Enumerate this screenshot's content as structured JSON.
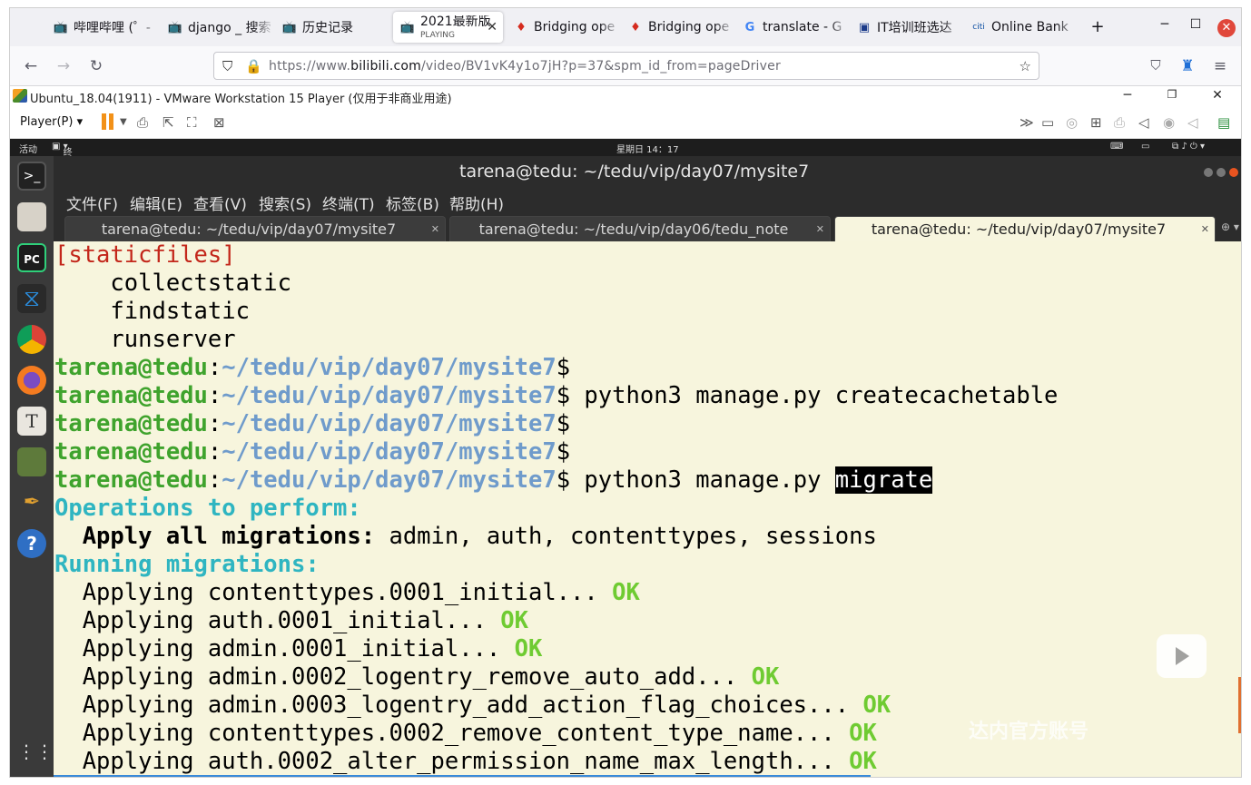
{
  "browser": {
    "tabs": [
      {
        "label": "哔哩哔哩 (゜-",
        "icon": "bilibili-icon"
      },
      {
        "label": "django _ 搜索",
        "icon": "bilibili-icon"
      },
      {
        "label": "历史记录",
        "icon": "bilibili-icon"
      },
      {
        "label": "2021最新版",
        "sublabel": "PLAYING",
        "icon": "bilibili-icon",
        "active": true
      },
      {
        "label": "Bridging ope",
        "icon": "maple-leaf-icon"
      },
      {
        "label": "Bridging ope",
        "icon": "maple-leaf-icon"
      },
      {
        "label": "translate - G",
        "icon": "google-icon"
      },
      {
        "label": "IT培训班选达",
        "icon": "site-icon"
      },
      {
        "label": "Online Bank",
        "icon": "citi-icon"
      }
    ],
    "new_tab": "+",
    "url_prefix": "https://www.",
    "url_domain": "bilibili.com",
    "url_rest": "/video/BV1vK4y1o7jH?p=37&spm_id_from=pageDriver"
  },
  "vmware": {
    "title": "Ubuntu_18.04(1911) - VMware Workstation 15 Player (仅用于非商业用途)",
    "player_menu": "Player(P)"
  },
  "ubuntu": {
    "activities": "活动",
    "app_menu": "终端",
    "clock": "星期日 14：17"
  },
  "terminal": {
    "title": "tarena@tedu: ~/tedu/vip/day07/mysite7",
    "menu": [
      "文件(F)",
      "编辑(E)",
      "查看(V)",
      "搜索(S)",
      "终端(T)",
      "标签(B)",
      "帮助(H)"
    ],
    "tabs": [
      {
        "label": "tarena@tedu: ~/tedu/vip/day07/mysite7"
      },
      {
        "label": "tarena@tedu: ~/tedu/vip/day06/tedu_note"
      },
      {
        "label": "tarena@tedu: ~/tedu/vip/day07/mysite7",
        "active": true
      }
    ],
    "user_host": "tarena@tedu",
    "path": "~/tedu/vip/day07/mysite7",
    "lines": {
      "staticfiles": "[staticfiles]",
      "cmd1": "    collectstatic",
      "cmd2": "    findstatic",
      "cmd3": "    runserver",
      "createcache": " python3 manage.py createcachetable",
      "migrate_pre": " python3 manage.py ",
      "migrate_sel": "migrate",
      "ops": "Operations to perform:",
      "apply_all": "  Apply all migrations:",
      "apps": " admin, auth, contenttypes, sessions",
      "running": "Running migrations:",
      "m1": "  Applying contenttypes.0001_initial... ",
      "m2": "  Applying auth.0001_initial... ",
      "m3": "  Applying admin.0001_initial... ",
      "m4": "  Applying admin.0002_logentry_remove_auto_add... ",
      "m5": "  Applying admin.0003_logentry_add_action_flag_choices... ",
      "m6": "  Applying contenttypes.0002_remove_content_type_name... ",
      "m7": "  Applying auth.0002_alter_permission_name_max_length... ",
      "ok": "OK"
    }
  },
  "watermark": "达内官方账号",
  "colors": {
    "terminal_bg": "#f7f5dd",
    "prompt_green": "#3fa32d",
    "path_blue": "#6f9bcb",
    "cyan": "#2fb5c1",
    "ok_green": "#6fcb32"
  }
}
